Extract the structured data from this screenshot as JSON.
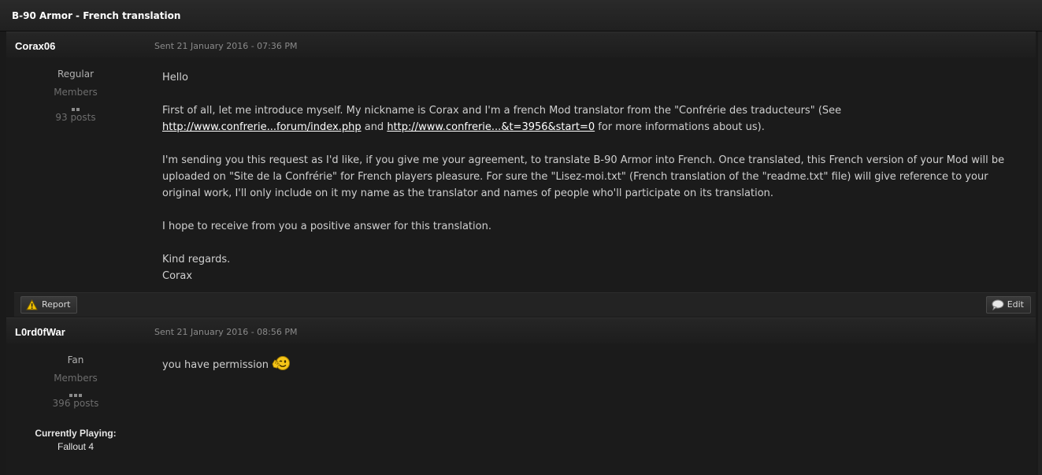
{
  "topic": {
    "title": "B-90 Armor - French translation"
  },
  "posts": [
    {
      "author": "Corax06",
      "sent": "Sent 21 January 2016 - 07:36 PM",
      "rank": "Regular",
      "group": "Members",
      "pips": 2,
      "post_count": "93 posts",
      "paragraphs": {
        "p1": "Hello",
        "p2_a": "First of all, let me introduce myself. My nickname is Corax and I'm a french Mod translator from the \"Confrérie des traducteurs\" (See ",
        "link1": "http://www.confrerie...forum/index.php",
        "p2_b": " and ",
        "link2": "http://www.confrerie...&t=3956&start=0",
        "p2_c": " for more informations about us).",
        "p3": "I'm sending you this request as I'd like, if you give me your agreement, to translate B-90 Armor into French. Once translated, this French version of your Mod will be uploaded on \"Site de la Confrérie\" for French players pleasure. For sure the \"Lisez-moi.txt\" (French translation of the \"readme.txt\" file) will give reference to your original work, I'll only include on it my name as the translator and names of people who'll participate on its translation.",
        "p4": "I hope to receive from you a positive answer for this translation.",
        "p5_a": "Kind regards.",
        "p5_b": "Corax"
      },
      "actions": {
        "report": "Report",
        "edit": "Edit"
      }
    },
    {
      "author": "L0rd0fWar",
      "sent": "Sent 21 January 2016 - 08:56 PM",
      "rank": "Fan",
      "group": "Members",
      "pips": 3,
      "post_count": "396 posts",
      "playing_label": "Currently Playing:",
      "playing_value": "Fallout 4",
      "message": "you have permission",
      "emoticon": "wink-wave-icon"
    }
  ]
}
